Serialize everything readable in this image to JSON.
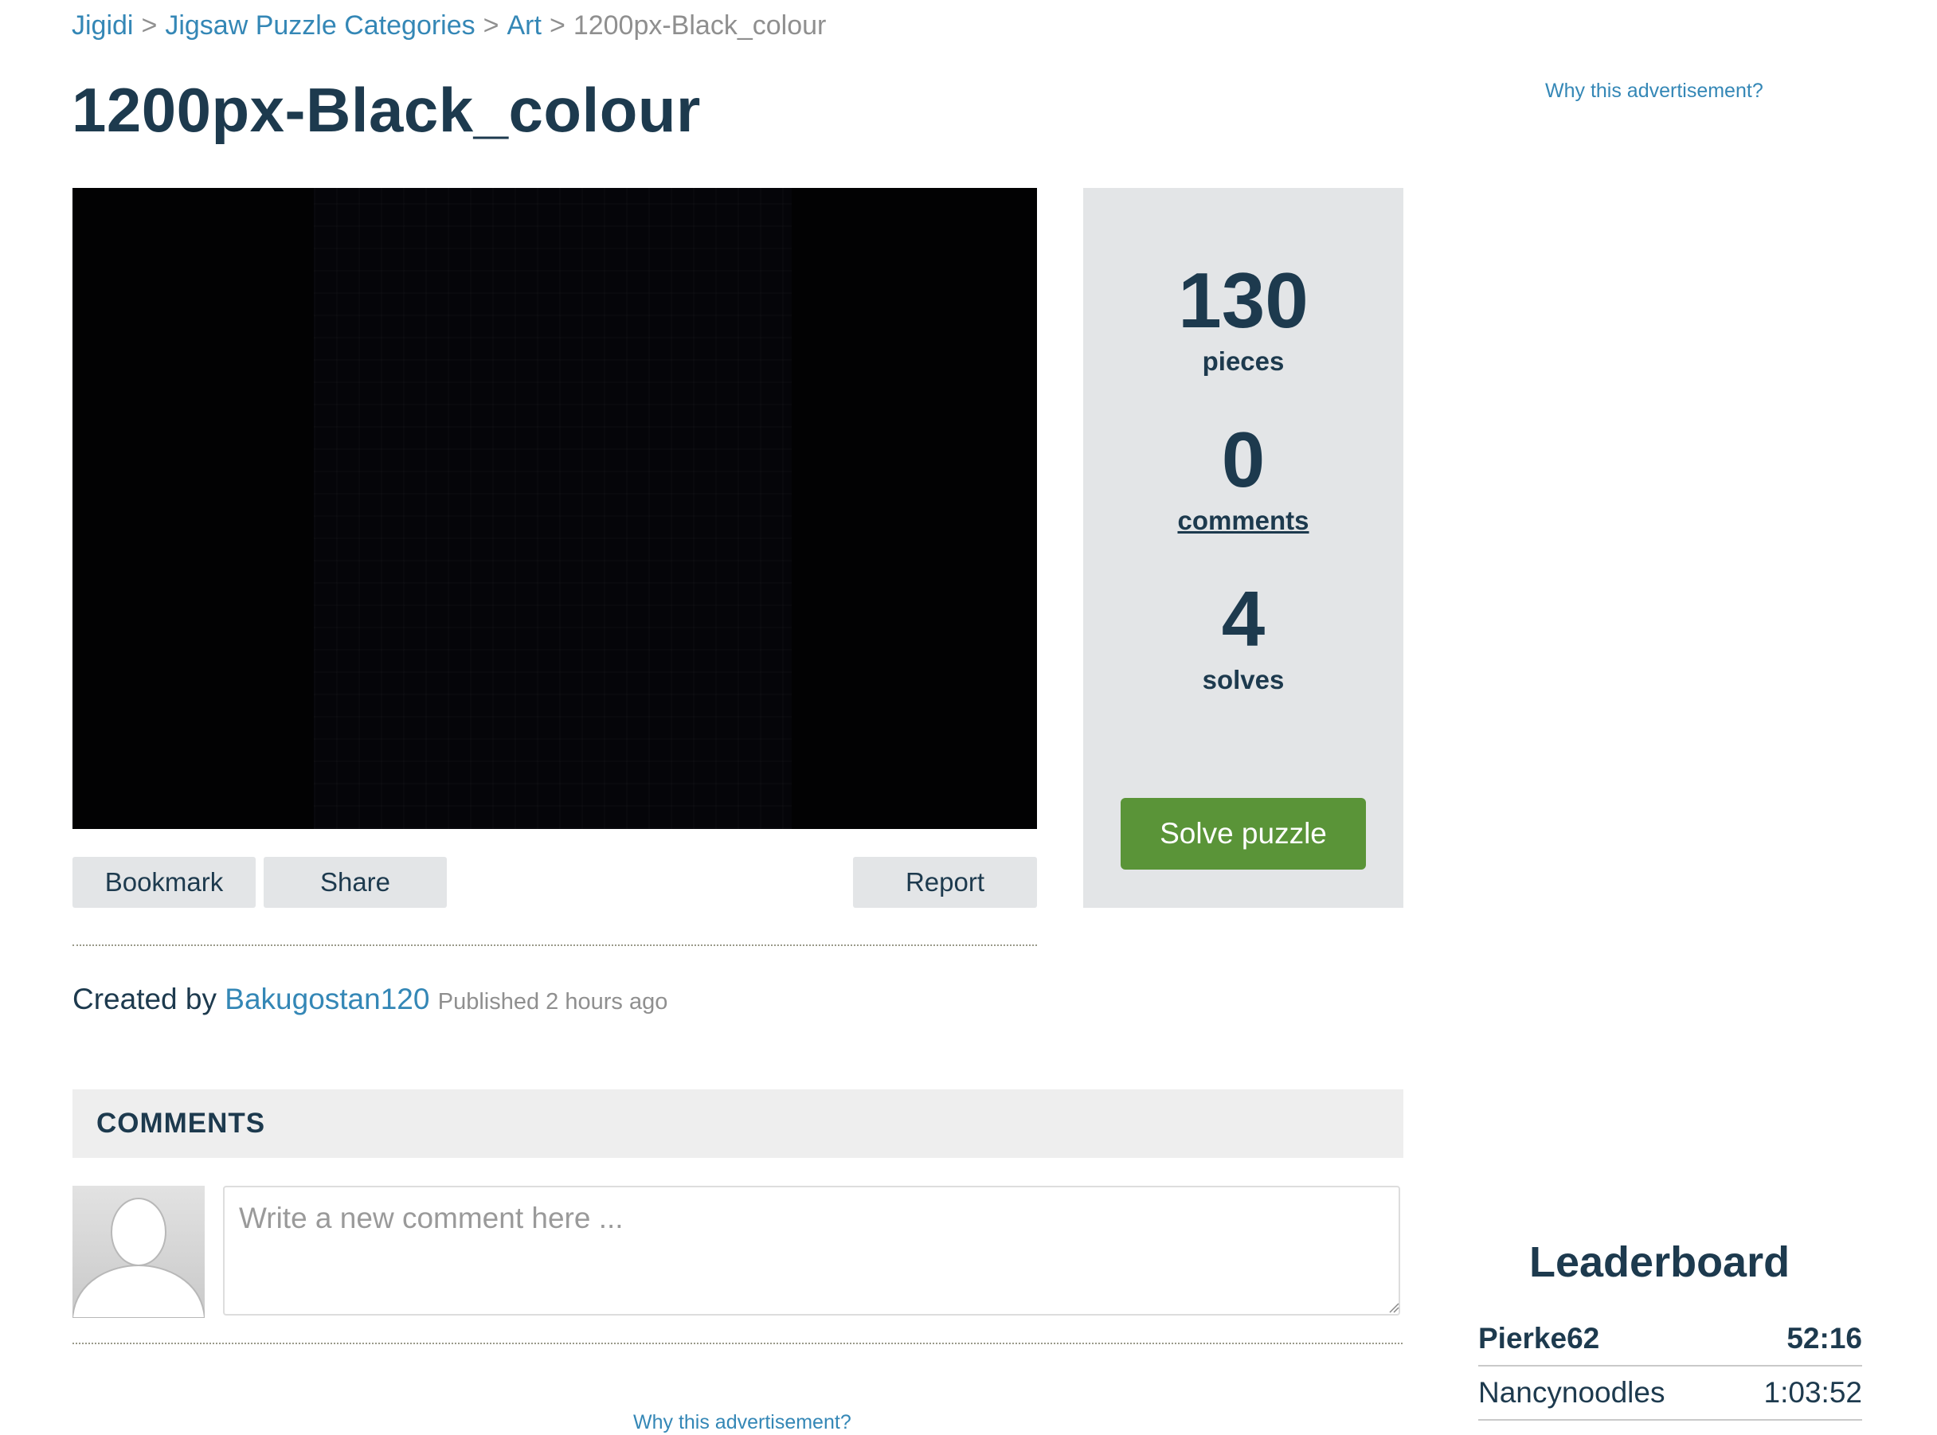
{
  "breadcrumb": {
    "items": [
      "Jigidi",
      "Jigsaw Puzzle Categories",
      "Art"
    ],
    "current": "1200px-Black_colour",
    "separator": ">"
  },
  "page": {
    "title": "1200px-Black_colour"
  },
  "ads": {
    "why_label_top": "Why this advertisement?",
    "why_label_bottom": "Why this advertisement?"
  },
  "actions": {
    "bookmark": "Bookmark",
    "share": "Share",
    "report": "Report"
  },
  "stats": {
    "pieces_count": "130",
    "pieces_label": "pieces",
    "comments_count": "0",
    "comments_label": "comments",
    "solves_count": "4",
    "solves_label": "solves",
    "solve_button": "Solve puzzle"
  },
  "creator": {
    "prefix": "Created by",
    "author": "Bakugostan120",
    "published": "Published 2 hours ago"
  },
  "comments": {
    "header": "COMMENTS",
    "placeholder": "Write a new comment here ..."
  },
  "leaderboard": {
    "title": "Leaderboard",
    "rows": [
      {
        "name": "Pierke62",
        "time": "52:16"
      },
      {
        "name": "Nancynoodles",
        "time": "1:03:52"
      }
    ]
  },
  "colors": {
    "link": "#3487b6",
    "heading": "#1d3a4e",
    "solve_button": "#5a9438",
    "panel": "#e3e5e7"
  }
}
